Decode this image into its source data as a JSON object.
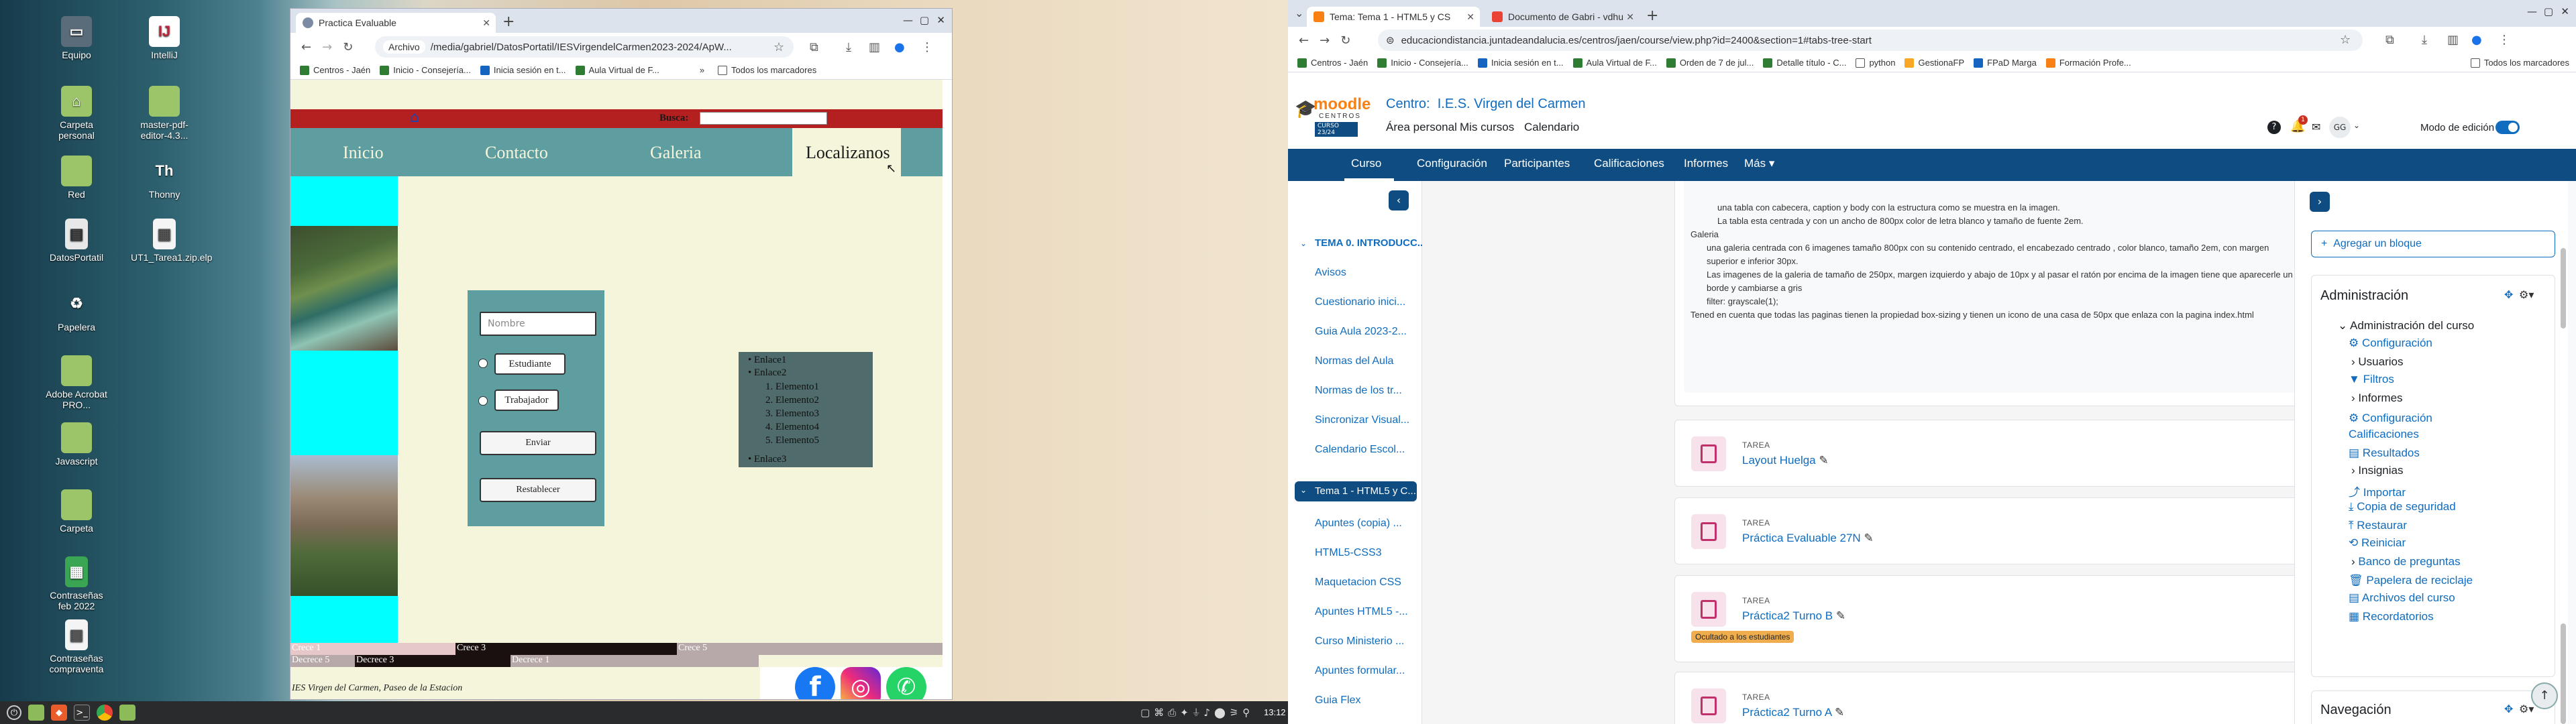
{
  "desktop": {
    "icons": [
      {
        "label": "Equipo"
      },
      {
        "label": "IntelliJ"
      },
      {
        "label": "Carpeta personal"
      },
      {
        "label": "master-pdf-editor-4.3..."
      },
      {
        "label": "Red"
      },
      {
        "label": "Thonny"
      },
      {
        "label": "DatosPortatil"
      },
      {
        "label": "UT1_Tarea1.zip.elp"
      },
      {
        "label": "Papelera"
      },
      {
        "label": "Adobe Acrobat PRO..."
      },
      {
        "label": "Javascript"
      },
      {
        "label": "Carpeta"
      },
      {
        "label": "Contraseñas feb 2022"
      },
      {
        "label": "Contraseñas compraventa"
      }
    ]
  },
  "browser_left": {
    "tab_title": "Practica Evaluable",
    "url_chip": "Archivo",
    "url": "/media/gabriel/DatosPortatil/IESVirgendelCarmen2023-2024/ApW...",
    "bookmarks": [
      "Centros - Jaén",
      "Inicio - Consejería...",
      "Inicia sesión en t...",
      "Aula Virtual de F..."
    ],
    "bookmarks_overflow": "»",
    "bookmarks_folder": "Todos los marcadores"
  },
  "page1": {
    "search_label": "Busca:",
    "nav": [
      "Inicio",
      "Contacto",
      "Galeria",
      "Localizanos"
    ],
    "form": {
      "name_placeholder": "Nombre",
      "radio1": "Estudiante",
      "radio2": "Trabajador",
      "submit": "Enviar",
      "reset": "Restablecer"
    },
    "list": {
      "items": [
        "Enlace1",
        "Enlace2"
      ],
      "sub": [
        "Elemento1",
        "Elemento2",
        "Elemento3",
        "Elemento4",
        "Elemento5"
      ],
      "last": "Enlace3"
    },
    "bars": {
      "crece1": "Crece 1",
      "crece3": "Crece 3",
      "crece5": "Crece 5",
      "decrece5": "Decrece 5",
      "decrece3": "Decrece 3",
      "decrece1": "Decrece 1"
    },
    "footer": "IES Virgen del Carmen, Paseo de la Estacion"
  },
  "taskbar": {
    "clock": "13:12"
  },
  "browser_right": {
    "tab1": "Tema: Tema 1 - HTML5 y CS",
    "tab2": "Documento de Gabri - vdhu",
    "url": "educaciondistancia.juntadeandalucia.es/centros/jaen/course/view.php?id=2400&section=1#tabs-tree-start",
    "bookmarks": [
      "Centros - Jaén",
      "Inicio - Consejería...",
      "Inicia sesión en t...",
      "Aula Virtual de F...",
      "Orden de 7 de jul...",
      "Detalle título - C...",
      "python",
      "GestionaFP",
      "FPaD Marga",
      "Formación Profe..."
    ],
    "bookmarks_folder": "Todos los marcadores"
  },
  "moodle": {
    "logo_text": "moodle",
    "logo_sub": "CENTROS",
    "logo_year": "CURSO 23/24",
    "centro": "Centro:  I.E.S. Virgen del Carmen",
    "top_links": [
      "Área personal",
      "Mis cursos",
      "Calendario"
    ],
    "badge_count": "1",
    "avatar": "GG",
    "edit_mode": "Modo de edición",
    "course_nav": [
      "Curso",
      "Configuración",
      "Participantes",
      "Calificaciones",
      "Informes",
      "Más"
    ],
    "sidebar": {
      "section0": "TEMA 0. INTRODUCC...",
      "section0_items": [
        "Avisos",
        "Cuestionario inici...",
        "Guia Aula 2023-2...",
        "Normas del Aula",
        "Normas de los tr...",
        "Sincronizar Visual...",
        "Calendario Escol..."
      ],
      "section1": "Tema 1 - HTML5 y C...",
      "section1_items": [
        "Apuntes (copia) ...",
        "HTML5-CSS3",
        "Maquetacion CSS",
        "Apuntes HTML5 -...",
        "Curso Ministerio ...",
        "Apuntes formular...",
        "Guia Flex"
      ]
    },
    "desc_lines": [
      "una tabla con cabecera, caption y body con la estructura como se muestra en la imagen.",
      "La tabla esta centrada y con un ancho de 800px color de letra blanco y tamaño de fuente 2em.",
      "Galeria",
      "una galeria centrada con 6 imagenes tamaño 800px con su contenido centrado, el encabezado centrado , color blanco, tamaño 2em, con margen",
      "superior e inferior 30px.",
      "Las imagenes de la galeria de tamaño de 250px, margen izquierdo y abajo de 10px y al pasar el ratón por encima de la imagen tiene que aparecerle un",
      "borde y cambiarse a gris",
      "filter: grayscale(1);",
      "Tened en cuenta que todas las paginas tienen la propiedad box-sizing y tienen un icono de una casa de 50px que enlaza con la pagina index.html"
    ],
    "activities": [
      {
        "type": "TAREA",
        "name": "Layout Huelga",
        "hidden": ""
      },
      {
        "type": "TAREA",
        "name": "Práctica Evaluable 27N",
        "hidden": ""
      },
      {
        "type": "TAREA",
        "name": "Práctica2 Turno B",
        "hidden": "Ocultado a los estudiantes"
      },
      {
        "type": "TAREA",
        "name": "Práctica2 Turno A",
        "hidden": ""
      }
    ],
    "add_block": "Agregar un bloque",
    "admin_title": "Administración",
    "admin_items": [
      "Administración del curso",
      "Configuración",
      "Usuarios",
      "Filtros",
      "Informes",
      "Configuración Calificaciones",
      "Resultados",
      "Insignias",
      "Importar",
      "Copia de seguridad",
      "Restaurar",
      "Reiniciar",
      "Banco de preguntas",
      "Papelera de reciclaje",
      "Archivos del curso",
      "Recordatorios"
    ],
    "nav_title": "Navegación"
  }
}
